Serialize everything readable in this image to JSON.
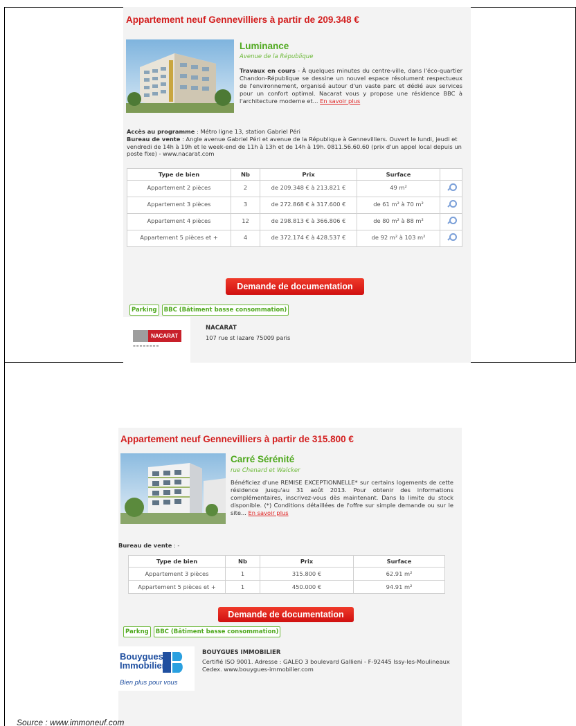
{
  "listings": [
    {
      "title": "Appartement neuf Gennevilliers à partir de 209.348 €",
      "program_name": "Luminance",
      "street": "Avenue de la République",
      "desc_lead": "Travaux en cours",
      "desc_text": " - À quelques minutes du centre-ville, dans l'éco-quartier Chandon-République se dessine un nouvel espace résolument respectueux de l'environnement, organisé autour d'un vaste parc et dédié aux services pour un confort optimal. Nacarat vous y propose une résidence BBC à l'architecture moderne et... ",
      "more_link": "En savoir plus",
      "access_label": "Accès au programme",
      "access_text": " : Métro ligne 13, station Gabriel Péri",
      "sales_label": "Bureau de vente",
      "sales_text": " : Angle avenue Gabriel Péri et avenue de la République à Gennevilliers. Ouvert le lundi, jeudi et vendredi de 14h à 19h et le week-end de 11h à 13h et de 14h à 19h. 0811.56.60.60 (prix d'un appel local depuis un poste fixe) - www.nacarat.com",
      "table_headers": [
        "Type de bien",
        "Nb",
        "Prix",
        "Surface",
        ""
      ],
      "rows": [
        {
          "type": "Appartement 2 pièces",
          "nb": "2",
          "prix": "de 209.348 € à 213.821 €",
          "surface": "49 m²"
        },
        {
          "type": "Appartement 3 pièces",
          "nb": "3",
          "prix": "de 272.868 € à 317.600 €",
          "surface": "de 61 m² à 70 m²"
        },
        {
          "type": "Appartement 4 pièces",
          "nb": "12",
          "prix": "de 298.813 € à 366.806 €",
          "surface": "de 80 m² à 88 m²"
        },
        {
          "type": "Appartement 5 pièces et +",
          "nb": "4",
          "prix": "de 372.174 € à 428.537 €",
          "surface": "de 92 m² à 103 m²"
        }
      ],
      "doc_button": "Demande de documentation",
      "tags": [
        "Parking",
        "BBC (Bâtiment basse consommation)"
      ],
      "builder_logo_text": "NACARAT",
      "builder_name": "NACARAT",
      "builder_address": "107 rue st lazare 75009 paris"
    },
    {
      "title": "Appartement neuf Gennevilliers à partir de 315.800 €",
      "program_name": "Carré Sérénité",
      "street": "rue Chenard et Walcker",
      "desc_text": "Bénéficiez d'une REMISE EXCEPTIONNELLE* sur certains logements de cette résidence jusqu'au 31 août 2013. Pour obtenir des informations complémentaires, inscrivez-vous dès maintenant. Dans la limite du stock disponible. (*) Conditions détaillées de l'offre sur simple demande ou sur le site... ",
      "more_link": "En savoir plus",
      "sales_label": "Bureau de vente",
      "sales_text": " : -",
      "table_headers": [
        "Type de bien",
        "Nb",
        "Prix",
        "Surface"
      ],
      "rows": [
        {
          "type": "Appartement 3 pièces",
          "nb": "1",
          "prix": "315.800 €",
          "surface": "62.91 m²"
        },
        {
          "type": "Appartement 5 pièces et +",
          "nb": "1",
          "prix": "450.000 €",
          "surface": "94.91 m²"
        }
      ],
      "doc_button": "Demande de documentation",
      "tags": [
        "Parkng",
        "BBC (Bâtiment basse consommation)"
      ],
      "builder_logo_line1": "Bouygues",
      "builder_logo_line2": "Immobilier",
      "builder_logo_tagline": "Bien plus pour vous",
      "builder_name": "BOUYGUES IMMOBILIER",
      "builder_address": "Certifié ISO 9001. Adresse : GALEO 3 boulevard Gallieni - F-92445 Issy-les-Moulineaux Cedex. www.bouygues-immobilier.com"
    }
  ],
  "source": "Source : www.immoneuf.com",
  "colors": {
    "title_red": "#d31e1e",
    "green": "#4ea81d",
    "button_red": "#e01818",
    "zoom_blue": "#7a9fd8"
  }
}
